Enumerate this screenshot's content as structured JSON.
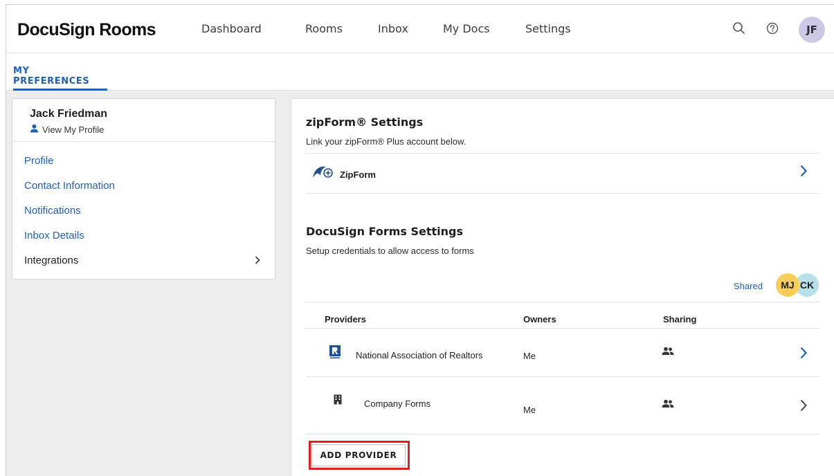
{
  "brand": {
    "name": "DocuSign Rooms"
  },
  "nav": {
    "items": [
      {
        "label": "Dashboard"
      },
      {
        "label": "Rooms"
      },
      {
        "label": "Inbox"
      },
      {
        "label": "My Docs"
      },
      {
        "label": "Settings"
      }
    ],
    "search_icon": "search-icon",
    "help_icon": "help-icon",
    "avatar_initials": "JF"
  },
  "subnav": {
    "tab_label": "MY PREFERENCES"
  },
  "sidebar": {
    "user_name": "Jack Friedman",
    "view_profile": "View My Profile",
    "items": [
      {
        "label": "Profile"
      },
      {
        "label": "Contact Information"
      },
      {
        "label": "Notifications"
      },
      {
        "label": "Inbox Details"
      },
      {
        "label": "Integrations"
      }
    ]
  },
  "zipform": {
    "title": "zipForm® Settings",
    "subtitle": "Link your zipForm® Plus account below.",
    "row_label": "ZipForm"
  },
  "forms": {
    "title": "DocuSign Forms Settings",
    "subtitle": "Setup credentials to allow access to forms",
    "shared_label": "Shared",
    "shared_avatars": [
      {
        "initials": "MJ",
        "color": "#f7cf58"
      },
      {
        "initials": "CK",
        "color": "#b9e0ea"
      }
    ],
    "columns": {
      "providers": "Providers",
      "owners": "Owners",
      "sharing": "Sharing"
    },
    "rows": [
      {
        "provider": "National Association of Realtors",
        "owner": "Me",
        "logo_icon": "realtor-logo-icon",
        "sharing_icon": "people-icon"
      },
      {
        "provider": "Company Forms",
        "owner": "Me",
        "logo_icon": "building-icon",
        "sharing_icon": "people-icon"
      }
    ],
    "add_button": "ADD PROVIDER"
  },
  "colors": {
    "accent": "#1f5fb8",
    "highlight": "#e02020",
    "background": "#ededed"
  }
}
